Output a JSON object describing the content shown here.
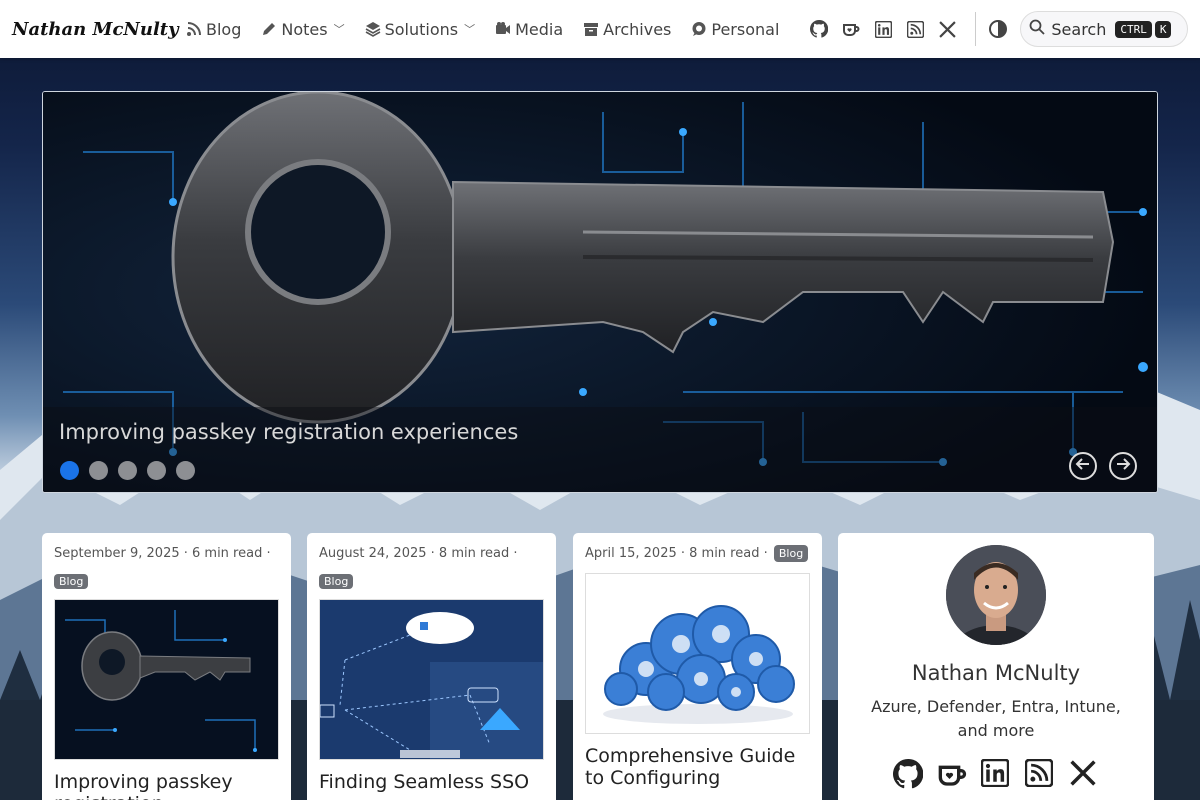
{
  "header": {
    "brand": "Nathan McNulty",
    "nav": [
      {
        "label": "Blog",
        "icon": "blog-icon",
        "dropdown": false
      },
      {
        "label": "Notes",
        "icon": "pencil-icon",
        "dropdown": true
      },
      {
        "label": "Solutions",
        "icon": "layers-icon",
        "dropdown": true
      },
      {
        "label": "Media",
        "icon": "video-camera-icon",
        "dropdown": false
      },
      {
        "label": "Archives",
        "icon": "archive-box-icon",
        "dropdown": false
      },
      {
        "label": "Personal",
        "icon": "chat-bubble-icon",
        "dropdown": false
      }
    ],
    "social": [
      "github-icon",
      "ko-fi-cup-icon",
      "linkedin-icon",
      "rss-icon",
      "x-twitter-icon"
    ],
    "search": {
      "label": "Search",
      "key1": "CTRL",
      "key2": "K"
    }
  },
  "hero": {
    "title": "Improving passkey registration experiences",
    "slides": 5,
    "active_slide": 1
  },
  "posts": [
    {
      "meta": "September 9, 2025 · 6 min read ·",
      "tag": "Blog",
      "title": "Improving passkey registration experiences"
    },
    {
      "meta": "August 24, 2025 · 8 min read ·",
      "tag": "Blog",
      "title": "Finding Seamless SSO"
    },
    {
      "meta": "April 15, 2025 · 8 min read ·",
      "tag": "Blog",
      "title": "Comprehensive Guide to Configuring"
    }
  ],
  "profile": {
    "name": "Nathan McNulty",
    "tagline": "Azure, Defender, Entra, Intune, and more",
    "social": [
      "github-icon",
      "ko-fi-cup-icon",
      "linkedin-icon",
      "rss-icon",
      "x-twitter-icon"
    ]
  },
  "colors": {
    "accent": "#1a73e8",
    "badge": "#6c6f75"
  }
}
